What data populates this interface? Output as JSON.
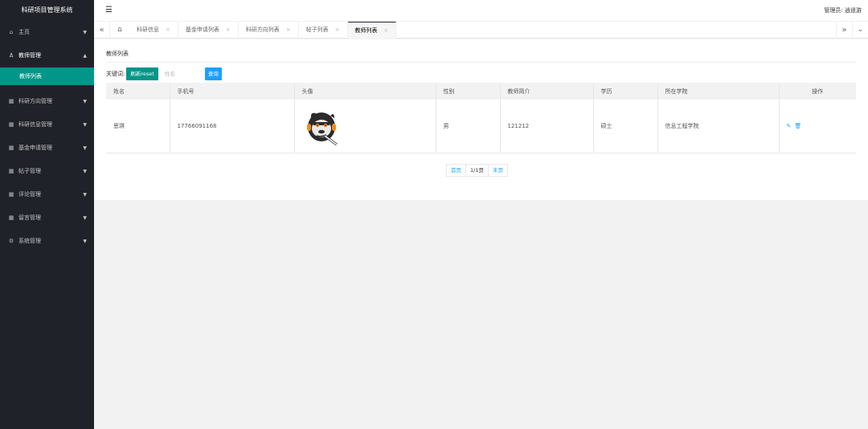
{
  "app": {
    "title": "科研项目管理系统"
  },
  "header": {
    "admin_text": "管理员: 逍遥游"
  },
  "sidebar": {
    "items": [
      {
        "label": "主页"
      },
      {
        "label": "教师管理",
        "sub": [
          {
            "label": "教师列表"
          }
        ]
      },
      {
        "label": "科研方向管理"
      },
      {
        "label": "科研信息管理"
      },
      {
        "label": "基金申请管理"
      },
      {
        "label": "帖子管理"
      },
      {
        "label": "评论管理"
      },
      {
        "label": "留言管理"
      },
      {
        "label": "系统管理"
      }
    ]
  },
  "tabs": [
    {
      "label": "科研信息"
    },
    {
      "label": "基金申请列表"
    },
    {
      "label": "科研方向列表"
    },
    {
      "label": "帖子列表"
    },
    {
      "label": "教师列表"
    }
  ],
  "main": {
    "title": "教师列表",
    "search": {
      "label": "关键词:",
      "refresh_label": "刷新reset",
      "placeholder": "姓名",
      "query_label": "查询"
    },
    "columns": [
      "姓名",
      "手机号",
      "头像",
      "性别",
      "教师简介",
      "学历",
      "所在学院",
      "操作"
    ],
    "rows": [
      {
        "name": "思琪",
        "phone": "17766091168",
        "gender": "男",
        "intro": "121212",
        "education": "硕士",
        "college": "信息工程学院"
      }
    ],
    "pager": {
      "first": "首页",
      "info": "1/1页",
      "last": "末页"
    }
  },
  "colors": {
    "sidebar_bg": "#20222a",
    "accent": "#009688",
    "blue": "#1e9fff"
  }
}
